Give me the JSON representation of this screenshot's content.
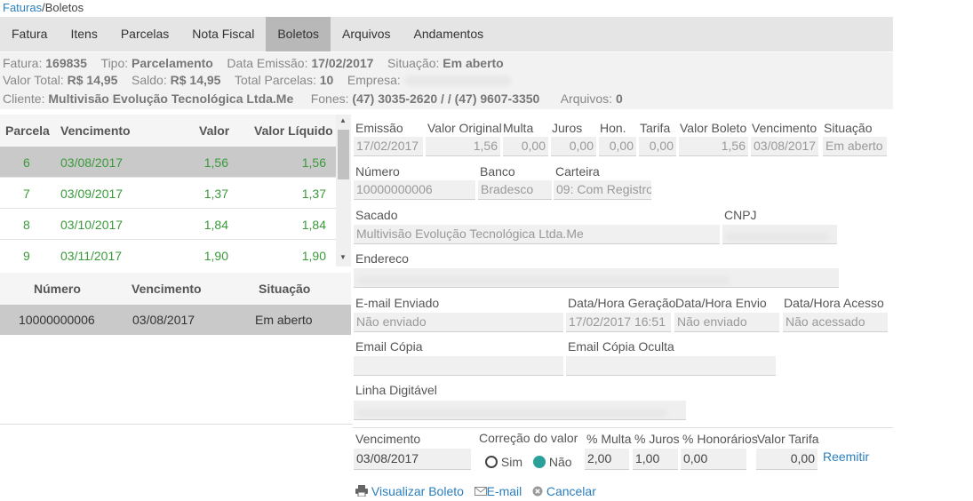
{
  "breadcrumb": {
    "parent": "Faturas",
    "sep": "/",
    "current": "Boletos"
  },
  "tabs": [
    "Fatura",
    "Itens",
    "Parcelas",
    "Nota Fiscal",
    "Boletos",
    "Arquivos",
    "Andamentos"
  ],
  "active_tab": "Boletos",
  "info": {
    "fatura_label": "Fatura:",
    "fatura": "169835",
    "tipo_label": "Tipo:",
    "tipo": "Parcelamento",
    "emissao_label": "Data Emissão:",
    "emissao": "17/02/2017",
    "situacao_label": "Situação:",
    "situacao": "Em aberto",
    "valor_total_label": "Valor Total:",
    "valor_total": "R$ 14,95",
    "saldo_label": "Saldo:",
    "saldo": "R$ 14,95",
    "total_parcelas_label": "Total Parcelas:",
    "total_parcelas": "10",
    "empresa_label": "Empresa:",
    "cliente_label": "Cliente:",
    "cliente": "Multivisão Evolução Tecnológica Ltda.Me",
    "fones_label": "Fones:",
    "fones": "(47) 3035-2620 / / (47) 9607-3350",
    "arquivos_label": "Arquivos:",
    "arquivos": "0"
  },
  "parcelas": {
    "headers": [
      "Parcela",
      "Vencimento",
      "Valor",
      "Valor Líquido"
    ],
    "rows": [
      {
        "parcela": "6",
        "vencimento": "03/08/2017",
        "valor": "1,56",
        "liquido": "1,56"
      },
      {
        "parcela": "7",
        "vencimento": "03/09/2017",
        "valor": "1,37",
        "liquido": "1,37"
      },
      {
        "parcela": "8",
        "vencimento": "03/10/2017",
        "valor": "1,84",
        "liquido": "1,84"
      },
      {
        "parcela": "9",
        "vencimento": "03/11/2017",
        "valor": "1,90",
        "liquido": "1,90"
      }
    ]
  },
  "boletos": {
    "headers": [
      "Número",
      "Vencimento",
      "Situação"
    ],
    "rows": [
      {
        "numero": "10000000006",
        "vencimento": "03/08/2017",
        "situacao": "Em aberto"
      }
    ]
  },
  "form": {
    "emissao_label": "Emissão",
    "emissao": "17/02/2017",
    "valor_original_label": "Valor Original",
    "valor_original": "1,56",
    "multa_label": "Multa",
    "multa": "0,00",
    "juros_label": "Juros",
    "juros": "0,00",
    "hon_label": "Hon.",
    "hon": "0,00",
    "tarifa_label": "Tarifa",
    "tarifa": "0,00",
    "valor_boleto_label": "Valor Boleto",
    "valor_boleto": "1,56",
    "vencimento_label": "Vencimento",
    "vencimento": "03/08/2017",
    "situacao_label": "Situação",
    "situacao": "Em aberto",
    "numero_label": "Número",
    "numero": "10000000006",
    "banco_label": "Banco",
    "banco": "Bradesco",
    "carteira_label": "Carteira",
    "carteira": "09: Com Registro",
    "sacado_label": "Sacado",
    "sacado": "Multivisão Evolução Tecnológica Ltda.Me",
    "cnpj_label": "CNPJ",
    "endereco_label": "Endereco",
    "email_enviado_label": "E-mail Enviado",
    "email_enviado": "Não enviado",
    "geracao_label": "Data/Hora Geração",
    "geracao": "17/02/2017 16:51",
    "envio_label": "Data/Hora Envio",
    "envio": "Não enviado",
    "acesso_label": "Data/Hora Acesso",
    "acesso": "Não acessado",
    "email_copia_label": "Email Cópia",
    "email_copia_oculta_label": "Email Cópia Oculta",
    "linha_label": "Linha Digitável"
  },
  "reemitir": {
    "vencimento_label": "Vencimento",
    "vencimento": "03/08/2017",
    "correcao_label": "Correção do valor",
    "sim": "Sim",
    "nao": "Não",
    "pct_multa_label": "% Multa",
    "pct_multa": "2,00",
    "pct_juros_label": "% Juros",
    "pct_juros": "1,00",
    "pct_hon_label": "% Honorários",
    "pct_hon": "0,00",
    "valor_tarifa_label": "Valor Tarifa",
    "valor_tarifa": "0,00",
    "reemitir": "Reemitir"
  },
  "actions": {
    "visualizar": "Visualizar Boleto",
    "email": "E-mail",
    "cancelar": "Cancelar"
  },
  "colors": {
    "accent": "#2a7fbf",
    "green": "#3a9a3a",
    "teal": "#2aa198",
    "tab_bg": "#e5e5e5",
    "tab_active": "#b8b8b8"
  },
  "icons": [
    "printer-icon",
    "envelope-icon",
    "cancel-icon",
    "scroll-up-icon",
    "scroll-down-icon"
  ]
}
